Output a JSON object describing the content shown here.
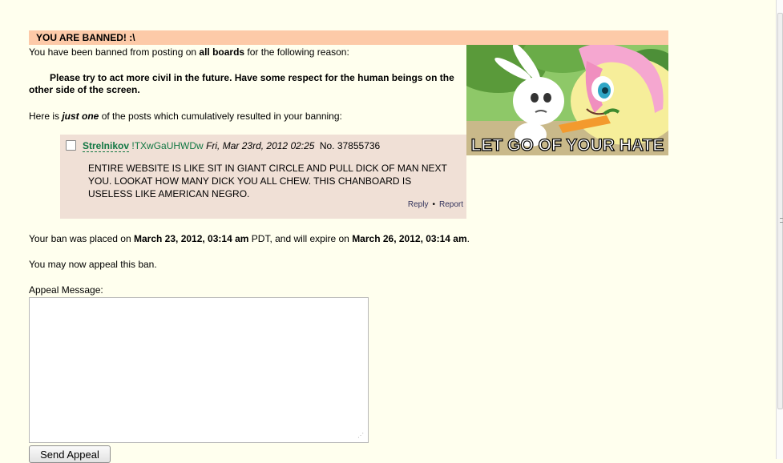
{
  "ban": {
    "header": "YOU ARE BANNED! :\\",
    "intro_pre": "You have been banned from posting on ",
    "intro_bold": "all boards",
    "intro_post": " for the following reason:",
    "reason": "Please try to act more civil in the future. Have some respect for the human beings on the other side of the screen.",
    "posts_pre": "Here is ",
    "posts_bold": "just one",
    "posts_post": " of the posts which cumulatively resulted in your banning:",
    "image_caption": "LET GO OF YOUR HATE",
    "placed_pre": "Your ban was placed on ",
    "placed_date": "March 23, 2012, 03:14 am",
    "placed_tz": " PDT",
    "expire_pre": ", and will expire on ",
    "expire_date": "March 26, 2012, 03:14 am",
    "expire_post": ".",
    "appeal_notice": "You may now appeal this ban.",
    "appeal_label": "Appeal Message:",
    "appeal_value": "",
    "send_label": "Send Appeal"
  },
  "post": {
    "name": "Strelnikov",
    "tripcode": "!TXwGaUHWDw",
    "date": "Fri, Mar 23rd, 2012 02:25",
    "number": "No. 37855736",
    "body": "ENTIRE WEBSITE IS LIKE SIT IN GIANT CIRCLE AND PULL DICK OF MAN NEXT YOU. LOOKAT HOW MANY DICK YOU ALL CHEW. THIS CHANBOARD IS USELESS LIKE AMERICAN NEGRO.",
    "reply_label": "Reply",
    "separator": "•",
    "report_label": "Report"
  },
  "colors": {
    "page_bg": "#ffffee",
    "header_bg": "#fdcaa8",
    "post_bg": "#f0e0d6",
    "name_green": "#117743",
    "link_blue": "#34345c"
  },
  "icons": {
    "checkbox": "post-select-checkbox",
    "resize_grip": "resize-grip-icon",
    "scrollbar": "vertical-scrollbar"
  }
}
